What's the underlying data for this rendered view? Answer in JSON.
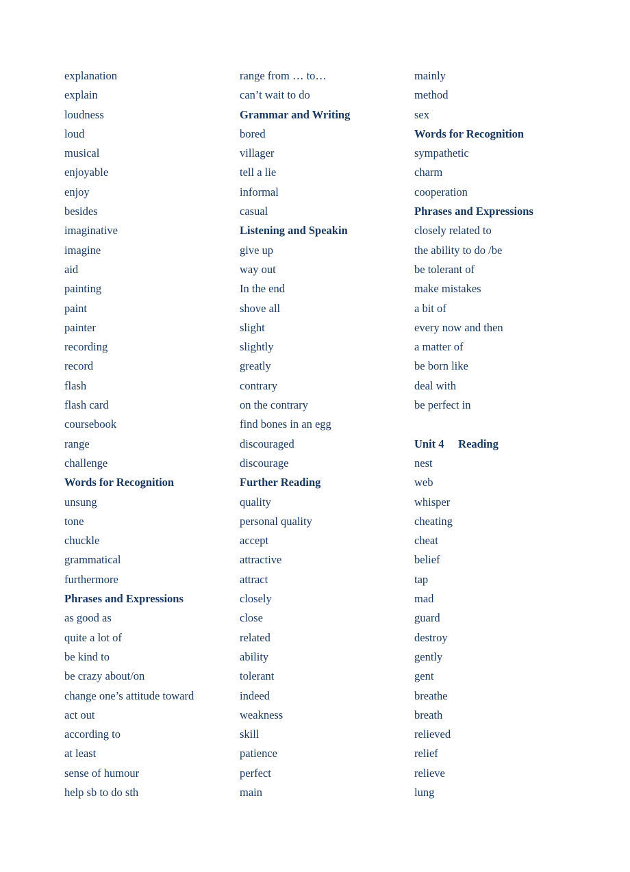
{
  "text_color": "#17375e",
  "columns": [
    {
      "entries": [
        {
          "text": "explanation",
          "type": "word"
        },
        {
          "text": "explain",
          "type": "word"
        },
        {
          "text": "loudness",
          "type": "word"
        },
        {
          "text": "loud",
          "type": "word"
        },
        {
          "text": "musical",
          "type": "word"
        },
        {
          "text": "enjoyable",
          "type": "word"
        },
        {
          "text": "enjoy",
          "type": "word"
        },
        {
          "text": "besides",
          "type": "word"
        },
        {
          "text": "imaginative",
          "type": "word"
        },
        {
          "text": "imagine",
          "type": "word"
        },
        {
          "text": "aid",
          "type": "word"
        },
        {
          "text": "painting",
          "type": "word"
        },
        {
          "text": "paint",
          "type": "word"
        },
        {
          "text": "painter",
          "type": "word"
        },
        {
          "text": "recording",
          "type": "word"
        },
        {
          "text": "record",
          "type": "word"
        },
        {
          "text": "flash",
          "type": "word"
        },
        {
          "text": "flash card",
          "type": "word"
        },
        {
          "text": "coursebook",
          "type": "word"
        },
        {
          "text": "range",
          "type": "word"
        },
        {
          "text": "challenge",
          "type": "word"
        },
        {
          "text": "Words for Recognition",
          "type": "heading"
        },
        {
          "text": "unsung",
          "type": "word"
        },
        {
          "text": "tone",
          "type": "word"
        },
        {
          "text": "chuckle",
          "type": "word"
        },
        {
          "text": "grammatical",
          "type": "word"
        },
        {
          "text": "furthermore",
          "type": "word"
        },
        {
          "text": "Phrases and Expressions",
          "type": "heading"
        },
        {
          "text": "as good as",
          "type": "word"
        },
        {
          "text": "quite a lot of",
          "type": "word"
        },
        {
          "text": "be kind to",
          "type": "word"
        },
        {
          "text": "be crazy about/on",
          "type": "word"
        },
        {
          "text": "change one’s attitude toward",
          "type": "word"
        },
        {
          "text": "act out",
          "type": "word"
        },
        {
          "text": "according to",
          "type": "word"
        },
        {
          "text": "at least",
          "type": "word"
        },
        {
          "text": "sense of humour",
          "type": "word"
        },
        {
          "text": "help sb to do sth",
          "type": "word"
        }
      ]
    },
    {
      "entries": [
        {
          "text": "range from … to…",
          "type": "word"
        },
        {
          "text": "can’t wait to do",
          "type": "word"
        },
        {
          "text": "Grammar and Writing",
          "type": "heading"
        },
        {
          "text": "bored",
          "type": "word"
        },
        {
          "text": "villager",
          "type": "word"
        },
        {
          "text": "tell a lie",
          "type": "word"
        },
        {
          "text": "informal",
          "type": "word"
        },
        {
          "text": "casual",
          "type": "word"
        },
        {
          "text": "Listening and Speakin",
          "type": "heading"
        },
        {
          "text": "give up",
          "type": "word"
        },
        {
          "text": "way out",
          "type": "word"
        },
        {
          "text": "In the end",
          "type": "word"
        },
        {
          "text": "shove all",
          "type": "word"
        },
        {
          "text": "slight",
          "type": "word"
        },
        {
          "text": "slightly",
          "type": "word"
        },
        {
          "text": "greatly",
          "type": "word"
        },
        {
          "text": "contrary",
          "type": "word"
        },
        {
          "text": "on the contrary",
          "type": "word"
        },
        {
          "text": "find bones in an egg",
          "type": "word"
        },
        {
          "text": "discouraged",
          "type": "word"
        },
        {
          "text": "discourage",
          "type": "word"
        },
        {
          "text": "Further Reading",
          "type": "heading"
        },
        {
          "text": "quality",
          "type": "word"
        },
        {
          "text": "personal quality",
          "type": "word"
        },
        {
          "text": "accept",
          "type": "word"
        },
        {
          "text": "attractive",
          "type": "word"
        },
        {
          "text": "attract",
          "type": "word"
        },
        {
          "text": "closely",
          "type": "word"
        },
        {
          "text": "close",
          "type": "word"
        },
        {
          "text": "related",
          "type": "word"
        },
        {
          "text": "ability",
          "type": "word"
        },
        {
          "text": "tolerant",
          "type": "word"
        },
        {
          "text": "indeed",
          "type": "word"
        },
        {
          "text": "weakness",
          "type": "word"
        },
        {
          "text": "skill",
          "type": "word"
        },
        {
          "text": "patience",
          "type": "word"
        },
        {
          "text": "perfect",
          "type": "word"
        },
        {
          "text": "main",
          "type": "word"
        }
      ]
    },
    {
      "entries": [
        {
          "text": "mainly",
          "type": "word"
        },
        {
          "text": "method",
          "type": "word"
        },
        {
          "text": "sex",
          "type": "word"
        },
        {
          "text": "Words for Recognition",
          "type": "heading"
        },
        {
          "text": "sympathetic",
          "type": "word"
        },
        {
          "text": "charm",
          "type": "word"
        },
        {
          "text": "cooperation",
          "type": "word"
        },
        {
          "text": "Phrases and Expressions",
          "type": "heading"
        },
        {
          "text": "closely related to",
          "type": "word"
        },
        {
          "text": "the ability to do /be",
          "type": "word"
        },
        {
          "text": "be tolerant of",
          "type": "word"
        },
        {
          "text": "make mistakes",
          "type": "word"
        },
        {
          "text": "a bit of",
          "type": "word"
        },
        {
          "text": "every now and then",
          "type": "word"
        },
        {
          "text": "a matter of",
          "type": "word"
        },
        {
          "text": "be born like",
          "type": "word"
        },
        {
          "text": "deal with",
          "type": "word"
        },
        {
          "text": "be perfect in",
          "type": "word"
        },
        {
          "text": "",
          "type": "blank"
        },
        {
          "text": "Unit 4     Reading",
          "type": "heading"
        },
        {
          "text": "nest",
          "type": "word"
        },
        {
          "text": "web",
          "type": "word"
        },
        {
          "text": "whisper",
          "type": "word"
        },
        {
          "text": "cheating",
          "type": "word"
        },
        {
          "text": "cheat",
          "type": "word"
        },
        {
          "text": "belief",
          "type": "word"
        },
        {
          "text": "tap",
          "type": "word"
        },
        {
          "text": "mad",
          "type": "word"
        },
        {
          "text": "guard",
          "type": "word"
        },
        {
          "text": "destroy",
          "type": "word"
        },
        {
          "text": "gently",
          "type": "word"
        },
        {
          "text": "gent",
          "type": "word"
        },
        {
          "text": "breathe",
          "type": "word"
        },
        {
          "text": "breath",
          "type": "word"
        },
        {
          "text": "relieved",
          "type": "word"
        },
        {
          "text": "relief",
          "type": "word"
        },
        {
          "text": "relieve",
          "type": "word"
        },
        {
          "text": "lung",
          "type": "word"
        }
      ]
    }
  ]
}
